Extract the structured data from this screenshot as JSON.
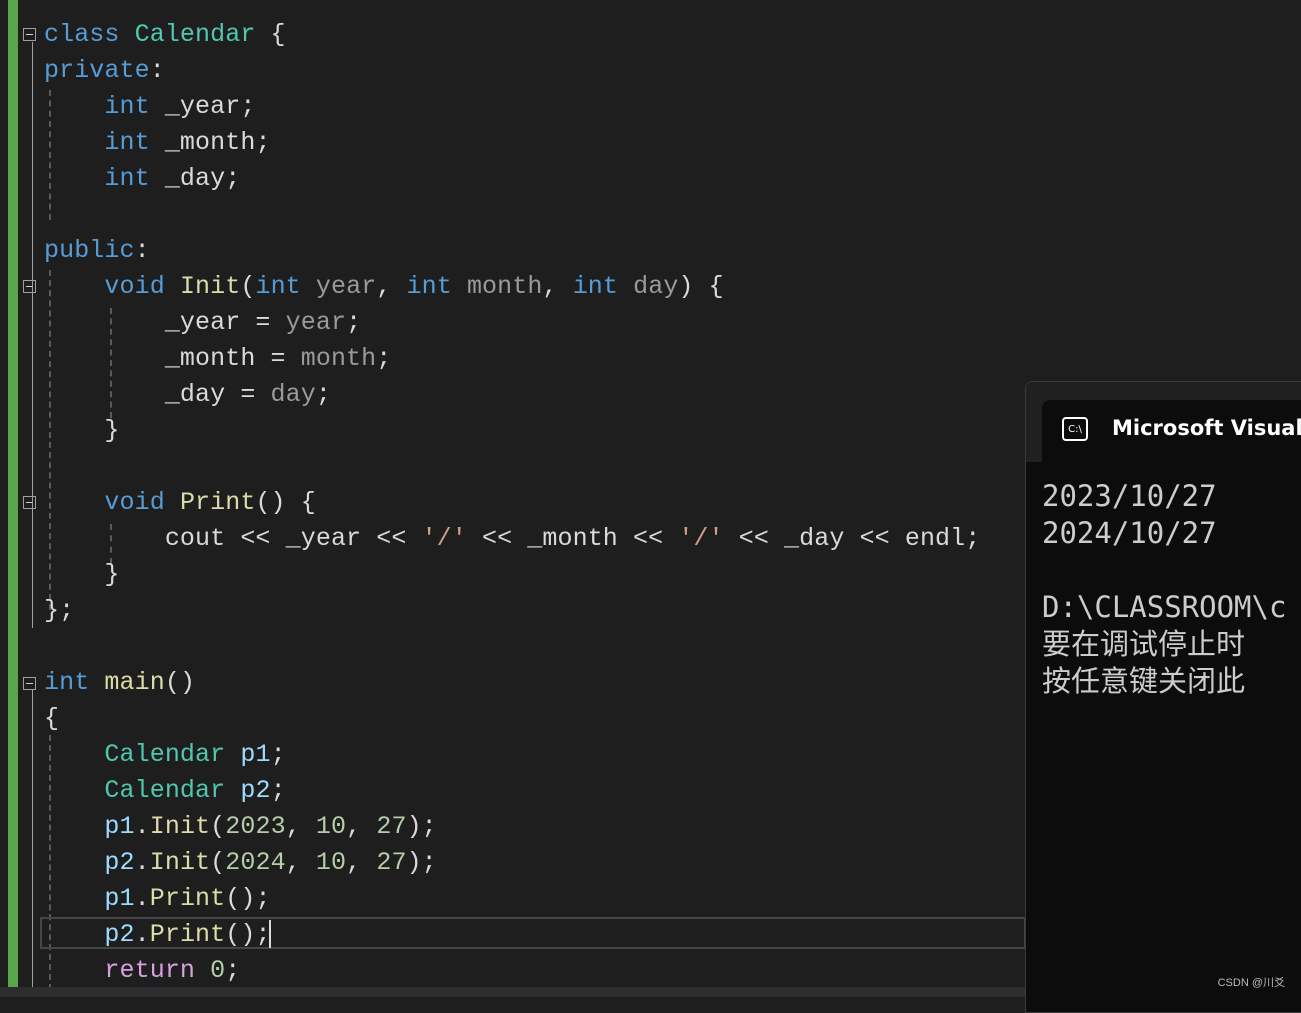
{
  "editor": {
    "lines": [
      [
        [
          "class ",
          "kw"
        ],
        [
          "Calendar",
          "ty"
        ],
        [
          " {",
          "pl"
        ]
      ],
      [
        [
          "private",
          "kw"
        ],
        [
          ":",
          "pl"
        ]
      ],
      [
        [
          "    int ",
          "kw"
        ],
        [
          "_year;",
          "pl"
        ]
      ],
      [
        [
          "    int ",
          "kw"
        ],
        [
          "_month;",
          "pl"
        ]
      ],
      [
        [
          "    int ",
          "kw"
        ],
        [
          "_day;",
          "pl"
        ]
      ],
      [],
      [
        [
          "public",
          "kw"
        ],
        [
          ":",
          "pl"
        ]
      ],
      [
        [
          "    void ",
          "kw"
        ],
        [
          "Init",
          "fn"
        ],
        [
          "(",
          "pl"
        ],
        [
          "int ",
          "kw"
        ],
        [
          "year",
          "pa"
        ],
        [
          ", ",
          "pl"
        ],
        [
          "int ",
          "kw"
        ],
        [
          "month",
          "pa"
        ],
        [
          ", ",
          "pl"
        ],
        [
          "int ",
          "kw"
        ],
        [
          "day",
          "pa"
        ],
        [
          ") {",
          "pl"
        ]
      ],
      [
        [
          "        _year = ",
          "pl"
        ],
        [
          "year",
          "pa"
        ],
        [
          ";",
          "pl"
        ]
      ],
      [
        [
          "        _month = ",
          "pl"
        ],
        [
          "month",
          "pa"
        ],
        [
          ";",
          "pl"
        ]
      ],
      [
        [
          "        _day = ",
          "pl"
        ],
        [
          "day",
          "pa"
        ],
        [
          ";",
          "pl"
        ]
      ],
      [
        [
          "    }",
          "pl"
        ]
      ],
      [],
      [
        [
          "    void ",
          "kw"
        ],
        [
          "Print",
          "fn"
        ],
        [
          "() {",
          "pl"
        ]
      ],
      [
        [
          "        cout << _year << ",
          "pl"
        ],
        [
          "'/'",
          "st"
        ],
        [
          " << _month << ",
          "pl"
        ],
        [
          "'/'",
          "st"
        ],
        [
          " << _day << endl;",
          "pl"
        ]
      ],
      [
        [
          "    }",
          "pl"
        ]
      ],
      [
        [
          "};",
          "pl"
        ]
      ],
      [],
      [
        [
          "int ",
          "kw"
        ],
        [
          "main",
          "fn"
        ],
        [
          "()",
          "pl"
        ]
      ],
      [
        [
          "{",
          "pl"
        ]
      ],
      [
        [
          "    Calendar ",
          "ty"
        ],
        [
          "p1",
          "lo"
        ],
        [
          ";",
          "pl"
        ]
      ],
      [
        [
          "    Calendar ",
          "ty"
        ],
        [
          "p2",
          "lo"
        ],
        [
          ";",
          "pl"
        ]
      ],
      [
        [
          "    p1",
          "lo"
        ],
        [
          ".",
          "pl"
        ],
        [
          "Init",
          "fn"
        ],
        [
          "(",
          "pl"
        ],
        [
          "2023",
          "nu"
        ],
        [
          ", ",
          "pl"
        ],
        [
          "10",
          "nu"
        ],
        [
          ", ",
          "pl"
        ],
        [
          "27",
          "nu"
        ],
        [
          ");",
          "pl"
        ]
      ],
      [
        [
          "    p2",
          "lo"
        ],
        [
          ".",
          "pl"
        ],
        [
          "Init",
          "fn"
        ],
        [
          "(",
          "pl"
        ],
        [
          "2024",
          "nu"
        ],
        [
          ", ",
          "pl"
        ],
        [
          "10",
          "nu"
        ],
        [
          ", ",
          "pl"
        ],
        [
          "27",
          "nu"
        ],
        [
          ");",
          "pl"
        ]
      ],
      [
        [
          "    p1",
          "lo"
        ],
        [
          ".",
          "pl"
        ],
        [
          "Print",
          "fn"
        ],
        [
          "();",
          "pl"
        ]
      ],
      [
        [
          "    p2",
          "lo"
        ],
        [
          ".",
          "pl"
        ],
        [
          "Print",
          "fn"
        ],
        [
          "();",
          "pl"
        ]
      ],
      [
        [
          "    return ",
          "rt"
        ],
        [
          "0",
          "nu"
        ],
        [
          ";",
          "pl"
        ]
      ]
    ]
  },
  "console": {
    "title": "Microsoft Visual S",
    "icon": "terminal-icon",
    "icon_text": "C:\\",
    "output": [
      "2023/10/27",
      "2024/10/27",
      "",
      "D:\\CLASSROOM\\c",
      "要在调试停止时",
      "按任意键关闭此"
    ]
  },
  "watermark": "CSDN @川爻",
  "colors": {
    "keyword": "#569cd6",
    "type": "#4ec9b0",
    "function": "#dcdcaa",
    "number": "#b5cea8",
    "string": "#d69d85",
    "change_bar": "#57a64a"
  }
}
